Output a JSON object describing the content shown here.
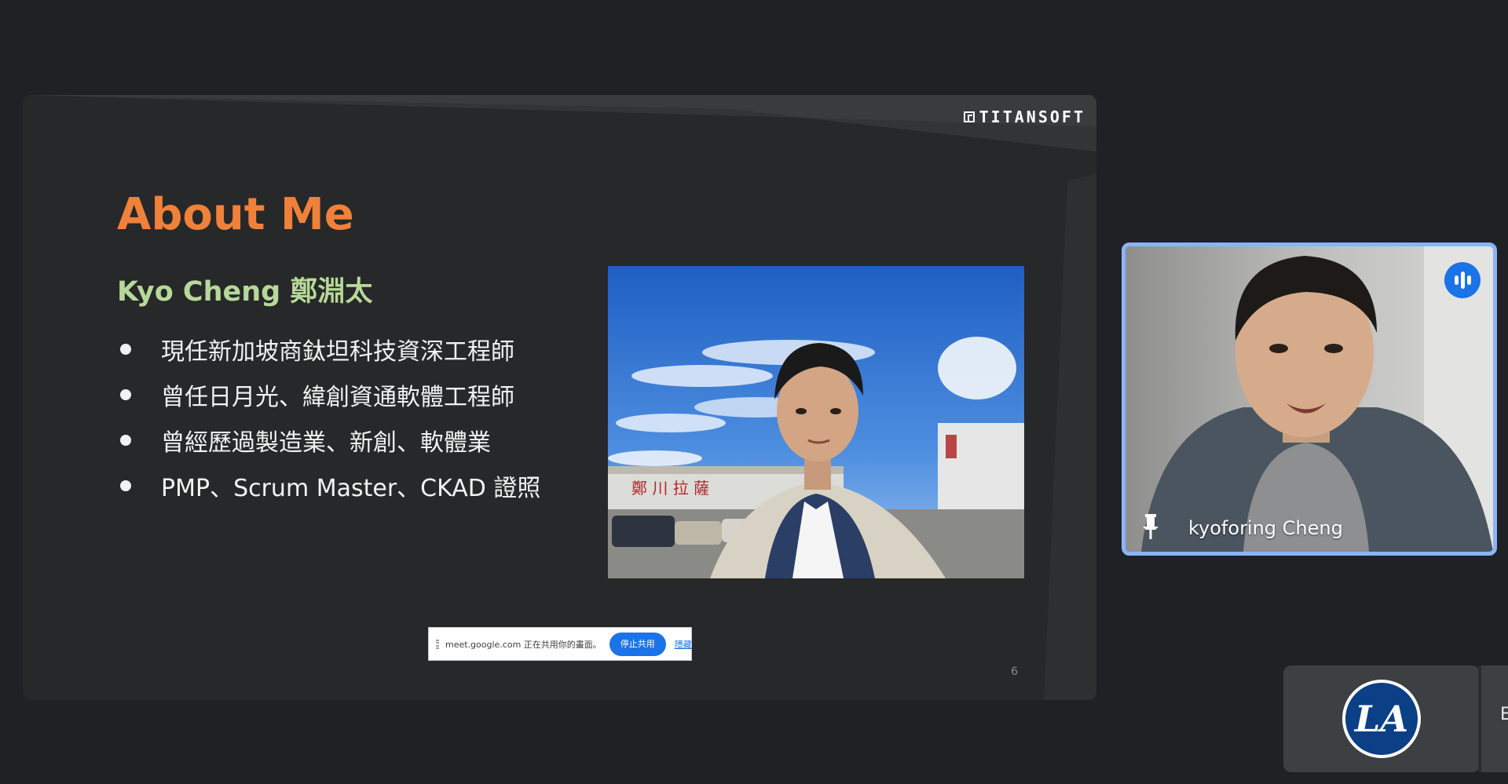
{
  "slide": {
    "logo_text": "TITANSOFT",
    "title": "About Me",
    "name": "Kyo Cheng 鄭淵太",
    "bullets": [
      "現任新加坡商鈦坦科技資深工程師",
      "曾任日月光、緯創資通軟體工程師",
      "曾經歷過製造業、新創、軟體業",
      "PMP、Scrum Master、CKAD 證照"
    ],
    "photo_signage": "鄭  川  拉  薩",
    "page_number": "6",
    "accent_color": "#f0813a",
    "name_color": "#b7d89a"
  },
  "share_banner": {
    "message": "meet.google.com 正在共用你的畫面。",
    "stop_label": "停止共用",
    "hide_label": "隱藏"
  },
  "participant": {
    "name": "kyoforing Cheng",
    "speaking_icon": "audio-level-icon",
    "pin_icon": "pin-icon",
    "border_color": "#8ab4f8"
  },
  "self_tile": {
    "avatar_text": "LA",
    "edge_char": "E"
  }
}
